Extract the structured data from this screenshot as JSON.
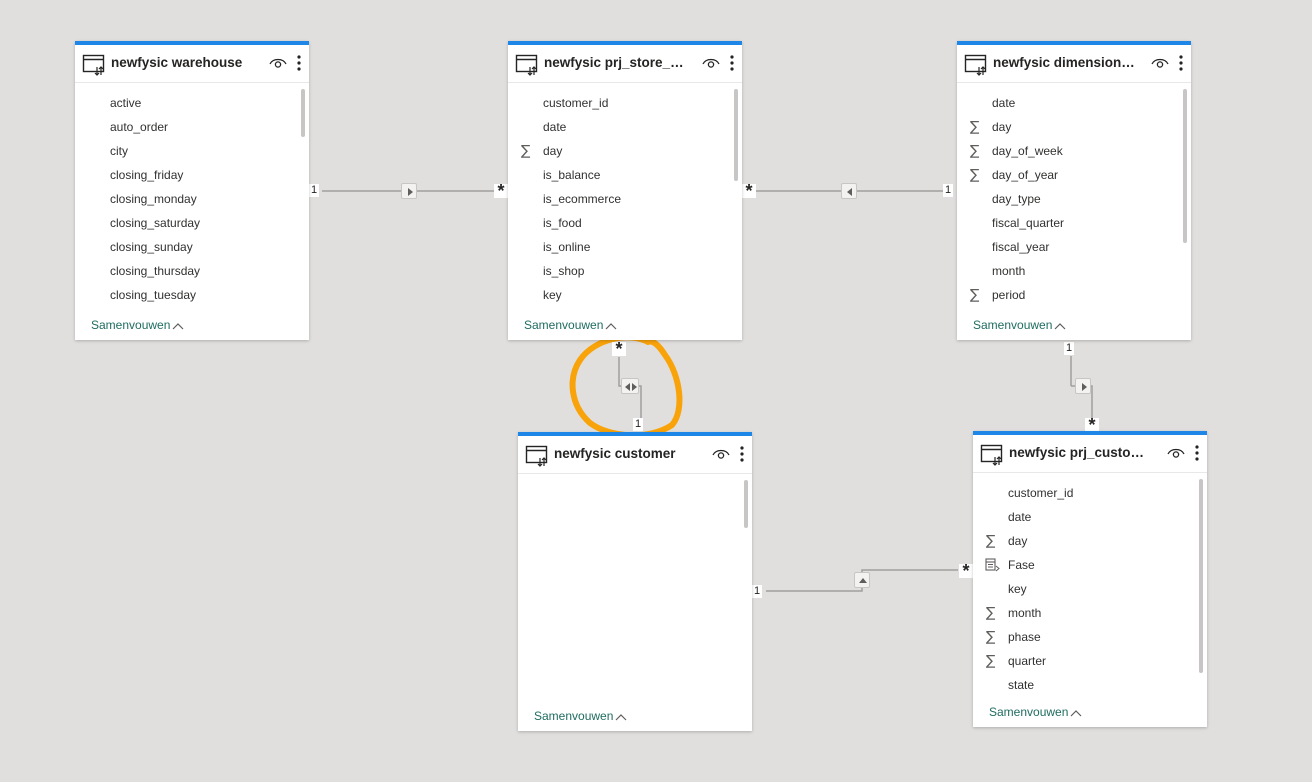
{
  "tables": [
    {
      "id": "warehouse",
      "title": "newfysic warehouse",
      "fields": [
        {
          "name": "active",
          "icon": ""
        },
        {
          "name": "auto_order",
          "icon": ""
        },
        {
          "name": "city",
          "icon": ""
        },
        {
          "name": "closing_friday",
          "icon": ""
        },
        {
          "name": "closing_monday",
          "icon": ""
        },
        {
          "name": "closing_saturday",
          "icon": ""
        },
        {
          "name": "closing_sunday",
          "icon": ""
        },
        {
          "name": "closing_thursday",
          "icon": ""
        },
        {
          "name": "closing_tuesday",
          "icon": ""
        }
      ],
      "collapse_label": "Samenvouwen"
    },
    {
      "id": "store_pe",
      "title": "newfysic prj_store_pe...",
      "fields": [
        {
          "name": "customer_id",
          "icon": ""
        },
        {
          "name": "date",
          "icon": ""
        },
        {
          "name": "day",
          "icon": "sigma-icon"
        },
        {
          "name": "is_balance",
          "icon": ""
        },
        {
          "name": "is_ecommerce",
          "icon": ""
        },
        {
          "name": "is_food",
          "icon": ""
        },
        {
          "name": "is_online",
          "icon": ""
        },
        {
          "name": "is_shop",
          "icon": ""
        },
        {
          "name": "key",
          "icon": ""
        }
      ],
      "collapse_label": "Samenvouwen"
    },
    {
      "id": "dimension",
      "title": "newfysic dimension_...",
      "fields": [
        {
          "name": "date",
          "icon": ""
        },
        {
          "name": "day",
          "icon": "sigma-icon"
        },
        {
          "name": "day_of_week",
          "icon": "sigma-icon"
        },
        {
          "name": "day_of_year",
          "icon": "sigma-icon"
        },
        {
          "name": "day_type",
          "icon": ""
        },
        {
          "name": "fiscal_quarter",
          "icon": ""
        },
        {
          "name": "fiscal_year",
          "icon": ""
        },
        {
          "name": "month",
          "icon": ""
        },
        {
          "name": "period",
          "icon": "sigma-icon"
        }
      ],
      "collapse_label": "Samenvouwen"
    },
    {
      "id": "customer",
      "title": "newfysic customer",
      "fields": [],
      "collapse_label": "Samenvouwen"
    },
    {
      "id": "prj_customer",
      "title": "newfysic prj_custome...",
      "fields": [
        {
          "name": "customer_id",
          "icon": ""
        },
        {
          "name": "date",
          "icon": ""
        },
        {
          "name": "day",
          "icon": "sigma-icon"
        },
        {
          "name": "Fase",
          "icon": "hierarchy-icon"
        },
        {
          "name": "key",
          "icon": ""
        },
        {
          "name": "month",
          "icon": "sigma-icon"
        },
        {
          "name": "phase",
          "icon": "sigma-icon"
        },
        {
          "name": "quarter",
          "icon": "sigma-icon"
        },
        {
          "name": "state",
          "icon": ""
        }
      ],
      "collapse_label": "Samenvouwen"
    }
  ],
  "relationships": {
    "one": "1",
    "many": "*"
  },
  "colors": {
    "canvas": "#e1dfdd",
    "card_accent": "#1e86e6",
    "collapse_link": "#1f6c60",
    "annotation": "#f9a30a"
  }
}
